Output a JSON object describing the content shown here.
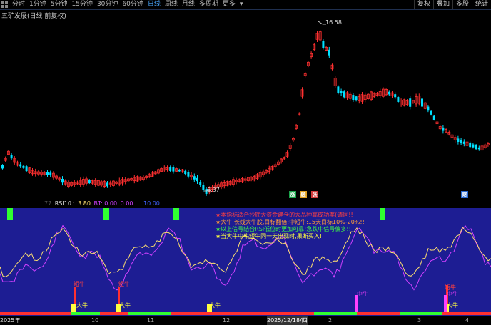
{
  "toolbar": {
    "tabs": [
      "分时",
      "1分钟",
      "5分钟",
      "15分钟",
      "30分钟",
      "60分钟",
      "日线",
      "周线",
      "月线",
      "多周期",
      "更多"
    ],
    "active_tab": "日线",
    "right_tools": [
      "复权",
      "叠加",
      "多股",
      "统计"
    ]
  },
  "stock_title": "五矿发展(日线 前复权)",
  "price_high_label": "16.58",
  "price_low_label": "6.37",
  "event_markers": [
    {
      "text": "涨",
      "color": "#1aa34a"
    },
    {
      "text": "融",
      "color": "#e0a020"
    },
    {
      "text": "张",
      "color": "#d23a3a"
    },
    {
      "text": "财",
      "color": "#2a6ad0"
    }
  ],
  "indicator_header": {
    "name": "RSI10",
    "value": "3.80",
    "bt": "BT: 0.00",
    "v2": "0.00",
    "v3": "10.00",
    "prefix": "77"
  },
  "notes": [
    {
      "text": "★本指标适合抄底大资金建仓的大品种高成功率(请同!!",
      "color": "#ff4040"
    },
    {
      "text": "★大牛:长线大牛股,目标翻倍;中短牛:15天目标10%-20%!!",
      "color": "#ff9a3a"
    },
    {
      "text": "★以上信号结合RSI低位时更加可靠!急跌中信号偏多!!",
      "color": "#40ff40"
    },
    {
      "text": "★当大牛中牛短牛同一天出现时,果断买入!!",
      "color": "#ffff40"
    }
  ],
  "signals": [
    {
      "text": "短牛",
      "color": "#ff4040"
    },
    {
      "text": "大牛",
      "color": "#ffff40"
    },
    {
      "text": "中牛",
      "color": "#ff40ff"
    }
  ],
  "date_axis": [
    "2025年",
    "10",
    "11",
    "12",
    "2025/12/18/四",
    "2",
    "3",
    "4"
  ],
  "colors": {
    "up": "#ff3030",
    "down": "#00e0ff",
    "background": "#000000",
    "indicator_bg": "#1d1d93",
    "line_yellow": "#ffe070",
    "line_magenta": "#d040ff",
    "active_tab": "#4aa8ff"
  }
}
